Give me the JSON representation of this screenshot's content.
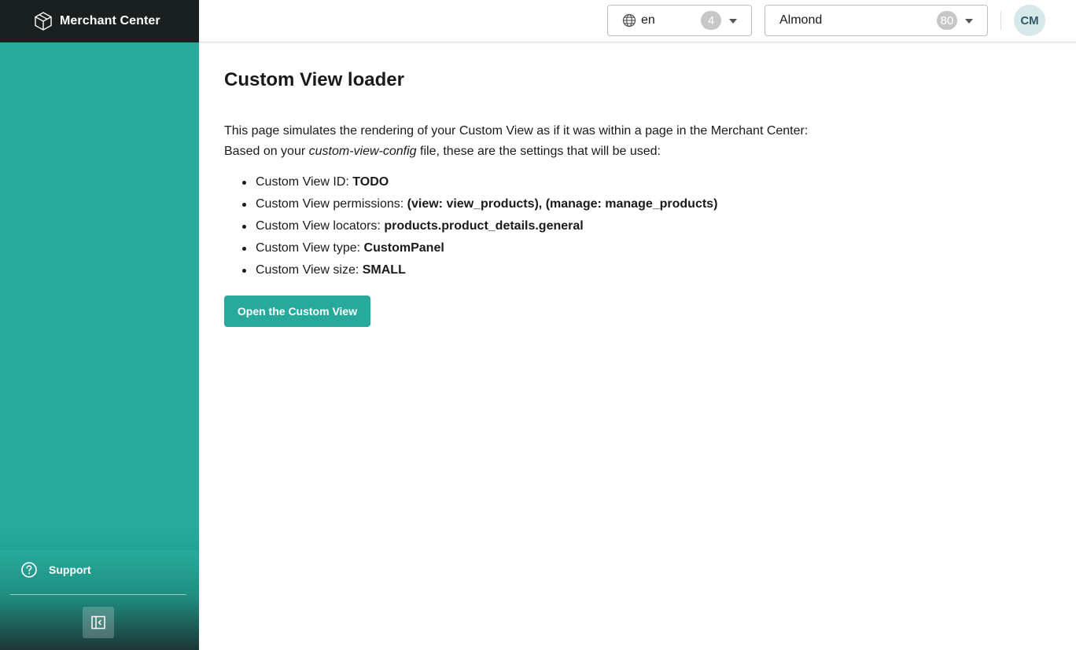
{
  "brand": {
    "name": "Merchant Center",
    "logo_icon": "cube-logo-icon"
  },
  "header": {
    "locale": {
      "value": "en",
      "count": "4",
      "icon": "globe-icon"
    },
    "project": {
      "value": "Almond",
      "count": "80"
    },
    "avatar_initials": "CM"
  },
  "sidebar": {
    "support_label": "Support",
    "support_icon": "question-circle-icon",
    "collapse_icon": "collapse-sidebar-icon"
  },
  "main": {
    "title": "Custom View loader",
    "intro_line1": "This page simulates the rendering of your Custom View as if it was within a page in the Merchant Center:",
    "intro_line2_prefix": "Based on your ",
    "intro_line2_em": "custom-view-config",
    "intro_line2_suffix": " file, these are the settings that will be used:",
    "settings": [
      {
        "label": "Custom View ID: ",
        "value": "TODO"
      },
      {
        "label": "Custom View permissions: ",
        "value": "(view: view_products), (manage: manage_products)"
      },
      {
        "label": "Custom View locators: ",
        "value": "products.product_details.general"
      },
      {
        "label": "Custom View type: ",
        "value": "CustomPanel"
      },
      {
        "label": "Custom View size: ",
        "value": "SMALL"
      }
    ],
    "open_button_label": "Open the Custom View"
  },
  "colors": {
    "accent": "#27aa9b",
    "brand_bar": "#1a1f1f",
    "avatar_bg": "#d6e8ea"
  }
}
